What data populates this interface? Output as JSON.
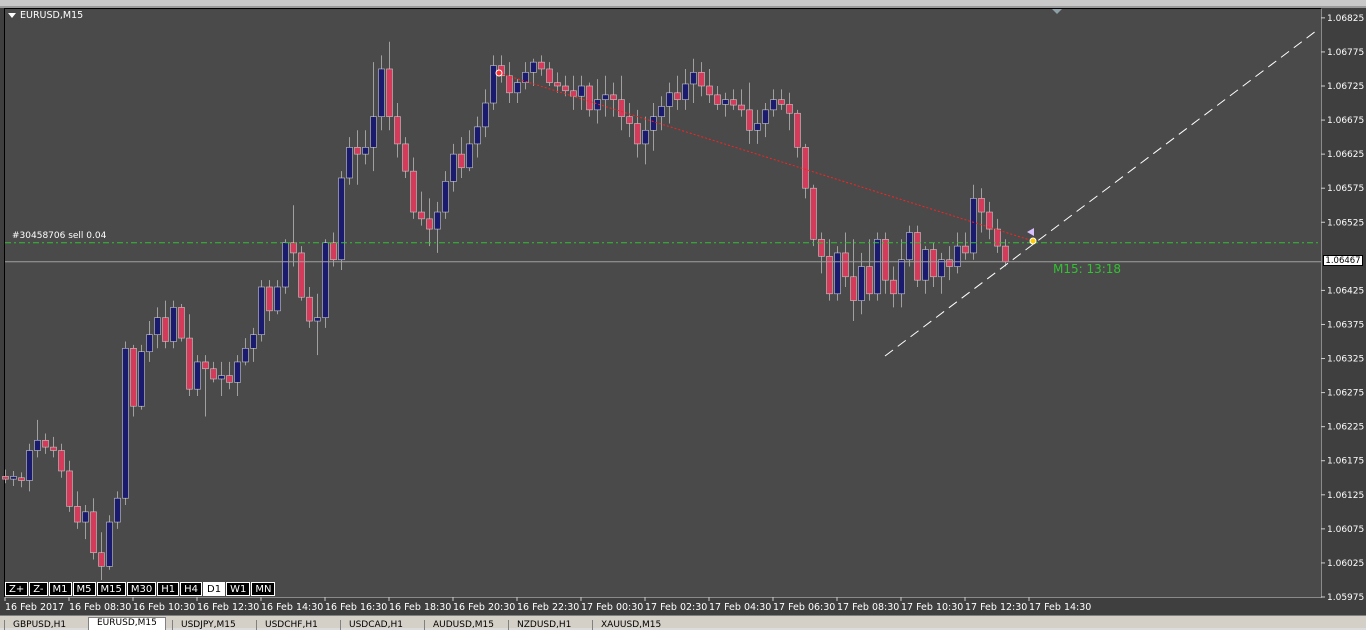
{
  "window": {
    "symbol_label": "EURUSD,M15"
  },
  "order_line": {
    "label": "#30458706 sell 0.04",
    "price": 1.06495,
    "color": "#33c033"
  },
  "current_price": {
    "value": 1.06467,
    "label": "1.06467",
    "color": "#a0a0a0"
  },
  "countdown": {
    "label": "M15: 13:18",
    "color": "#33c033"
  },
  "price_axis": {
    "labels": [
      "1.06825",
      "1.06775",
      "1.06725",
      "1.06675",
      "1.06625",
      "1.06575",
      "1.06525",
      "1.06425",
      "1.06375",
      "1.06325",
      "1.06275",
      "1.06225",
      "1.06175",
      "1.06125",
      "1.06075",
      "1.06025",
      "1.05975"
    ],
    "values": [
      1.06825,
      1.06775,
      1.06725,
      1.06675,
      1.06625,
      1.06575,
      1.06525,
      1.06425,
      1.06375,
      1.06325,
      1.06275,
      1.06225,
      1.06175,
      1.06125,
      1.06075,
      1.06025,
      1.05975
    ]
  },
  "time_axis": {
    "labels": [
      "16 Feb 2017",
      "16 Feb 08:30",
      "16 Feb 10:30",
      "16 Feb 12:30",
      "16 Feb 14:30",
      "16 Feb 16:30",
      "16 Feb 18:30",
      "16 Feb 20:30",
      "16 Feb 22:30",
      "17 Feb 00:30",
      "17 Feb 02:30",
      "17 Feb 04:30",
      "17 Feb 06:30",
      "17 Feb 08:30",
      "17 Feb 10:30",
      "17 Feb 12:30",
      "17 Feb 14:30"
    ]
  },
  "timeframe_buttons": [
    {
      "label": "Z+",
      "active": false
    },
    {
      "label": "Z-",
      "active": false
    },
    {
      "label": "M1",
      "active": false
    },
    {
      "label": "M5",
      "active": false
    },
    {
      "label": "M15",
      "active": false
    },
    {
      "label": "M30",
      "active": false
    },
    {
      "label": "H1",
      "active": false
    },
    {
      "label": "H4",
      "active": false
    },
    {
      "label": "D1",
      "active": true
    },
    {
      "label": "W1",
      "active": false
    },
    {
      "label": "MN",
      "active": false
    }
  ],
  "tabs": [
    {
      "label": "GBPUSD,H1",
      "active": false
    },
    {
      "label": "EURUSD,M15",
      "active": true
    },
    {
      "label": "USDJPY,M15",
      "active": false
    },
    {
      "label": "USDCHF,H1",
      "active": false
    },
    {
      "label": "USDCAD,H1",
      "active": false
    },
    {
      "label": "AUDUSD,M15",
      "active": false
    },
    {
      "label": "NZDUSD,H1",
      "active": false
    },
    {
      "label": "XAUUSD,M15",
      "active": false
    }
  ],
  "colors": {
    "bull": "#1a1a6e",
    "bear": "#d43a5a",
    "wick": "#a0a0a0",
    "background": "#4a4a4a"
  },
  "chart_data": {
    "type": "candlestick",
    "symbol": "EURUSD",
    "timeframe": "M15",
    "ylim": [
      1.05975,
      1.06838
    ],
    "candles": [
      {
        "o": 1.06152,
        "h": 1.06162,
        "l": 1.06142,
        "c": 1.06148
      },
      {
        "o": 1.06148,
        "h": 1.0616,
        "l": 1.06138,
        "c": 1.06152
      },
      {
        "o": 1.0615,
        "h": 1.06158,
        "l": 1.06136,
        "c": 1.06146
      },
      {
        "o": 1.06146,
        "h": 1.062,
        "l": 1.0613,
        "c": 1.0619
      },
      {
        "o": 1.0619,
        "h": 1.06235,
        "l": 1.0618,
        "c": 1.06205
      },
      {
        "o": 1.06205,
        "h": 1.06215,
        "l": 1.06185,
        "c": 1.06195
      },
      {
        "o": 1.06195,
        "h": 1.0621,
        "l": 1.0618,
        "c": 1.0619
      },
      {
        "o": 1.0619,
        "h": 1.062,
        "l": 1.0615,
        "c": 1.0616
      },
      {
        "o": 1.0616,
        "h": 1.06175,
        "l": 1.061,
        "c": 1.06108
      },
      {
        "o": 1.06108,
        "h": 1.0613,
        "l": 1.06075,
        "c": 1.06085
      },
      {
        "o": 1.06085,
        "h": 1.0611,
        "l": 1.0606,
        "c": 1.061
      },
      {
        "o": 1.061,
        "h": 1.0612,
        "l": 1.0603,
        "c": 1.0604
      },
      {
        "o": 1.0604,
        "h": 1.0607,
        "l": 1.06,
        "c": 1.0602
      },
      {
        "o": 1.0602,
        "h": 1.06095,
        "l": 1.06015,
        "c": 1.06085
      },
      {
        "o": 1.06085,
        "h": 1.0613,
        "l": 1.06075,
        "c": 1.0612
      },
      {
        "o": 1.0612,
        "h": 1.0635,
        "l": 1.0611,
        "c": 1.0634
      },
      {
        "o": 1.0634,
        "h": 1.06345,
        "l": 1.0624,
        "c": 1.06255
      },
      {
        "o": 1.06255,
        "h": 1.06345,
        "l": 1.0625,
        "c": 1.06335
      },
      {
        "o": 1.06335,
        "h": 1.0638,
        "l": 1.0632,
        "c": 1.0636
      },
      {
        "o": 1.0636,
        "h": 1.064,
        "l": 1.0634,
        "c": 1.06385
      },
      {
        "o": 1.06385,
        "h": 1.0641,
        "l": 1.0634,
        "c": 1.0635
      },
      {
        "o": 1.0635,
        "h": 1.0641,
        "l": 1.0634,
        "c": 1.064
      },
      {
        "o": 1.064,
        "h": 1.06405,
        "l": 1.0635,
        "c": 1.06355
      },
      {
        "o": 1.06355,
        "h": 1.0639,
        "l": 1.0627,
        "c": 1.0628
      },
      {
        "o": 1.0628,
        "h": 1.0633,
        "l": 1.0627,
        "c": 1.0632
      },
      {
        "o": 1.0632,
        "h": 1.0633,
        "l": 1.0624,
        "c": 1.0631
      },
      {
        "o": 1.0631,
        "h": 1.0632,
        "l": 1.0629,
        "c": 1.06295
      },
      {
        "o": 1.06295,
        "h": 1.0632,
        "l": 1.0627,
        "c": 1.063
      },
      {
        "o": 1.063,
        "h": 1.0632,
        "l": 1.0628,
        "c": 1.0629
      },
      {
        "o": 1.0629,
        "h": 1.0633,
        "l": 1.0627,
        "c": 1.0632
      },
      {
        "o": 1.0632,
        "h": 1.06355,
        "l": 1.06315,
        "c": 1.0634
      },
      {
        "o": 1.0634,
        "h": 1.0637,
        "l": 1.0632,
        "c": 1.0636
      },
      {
        "o": 1.0636,
        "h": 1.0644,
        "l": 1.0635,
        "c": 1.0643
      },
      {
        "o": 1.0643,
        "h": 1.0644,
        "l": 1.0638,
        "c": 1.06395
      },
      {
        "o": 1.06395,
        "h": 1.0644,
        "l": 1.0639,
        "c": 1.0643
      },
      {
        "o": 1.0643,
        "h": 1.065,
        "l": 1.0642,
        "c": 1.06495
      },
      {
        "o": 1.06495,
        "h": 1.0655,
        "l": 1.0646,
        "c": 1.0648
      },
      {
        "o": 1.0648,
        "h": 1.0649,
        "l": 1.0641,
        "c": 1.06415
      },
      {
        "o": 1.06415,
        "h": 1.0643,
        "l": 1.0637,
        "c": 1.0638
      },
      {
        "o": 1.0638,
        "h": 1.0642,
        "l": 1.0633,
        "c": 1.06385
      },
      {
        "o": 1.06385,
        "h": 1.065,
        "l": 1.0637,
        "c": 1.06495
      },
      {
        "o": 1.06495,
        "h": 1.0651,
        "l": 1.0646,
        "c": 1.0647
      },
      {
        "o": 1.0647,
        "h": 1.066,
        "l": 1.06455,
        "c": 1.0659
      },
      {
        "o": 1.0659,
        "h": 1.0665,
        "l": 1.0658,
        "c": 1.06635
      },
      {
        "o": 1.06635,
        "h": 1.0666,
        "l": 1.0658,
        "c": 1.06625
      },
      {
        "o": 1.06625,
        "h": 1.0666,
        "l": 1.0661,
        "c": 1.06635
      },
      {
        "o": 1.06635,
        "h": 1.0676,
        "l": 1.066,
        "c": 1.0668
      },
      {
        "o": 1.0668,
        "h": 1.0677,
        "l": 1.0666,
        "c": 1.0675
      },
      {
        "o": 1.0675,
        "h": 1.0679,
        "l": 1.0666,
        "c": 1.0668
      },
      {
        "o": 1.0668,
        "h": 1.067,
        "l": 1.0662,
        "c": 1.0664
      },
      {
        "o": 1.0664,
        "h": 1.0665,
        "l": 1.0659,
        "c": 1.066
      },
      {
        "o": 1.066,
        "h": 1.0662,
        "l": 1.0653,
        "c": 1.0654
      },
      {
        "o": 1.0654,
        "h": 1.0657,
        "l": 1.0652,
        "c": 1.0653
      },
      {
        "o": 1.0653,
        "h": 1.0656,
        "l": 1.0649,
        "c": 1.06515
      },
      {
        "o": 1.06515,
        "h": 1.06555,
        "l": 1.0648,
        "c": 1.0654
      },
      {
        "o": 1.0654,
        "h": 1.066,
        "l": 1.0653,
        "c": 1.06585
      },
      {
        "o": 1.06585,
        "h": 1.0664,
        "l": 1.0657,
        "c": 1.06625
      },
      {
        "o": 1.06625,
        "h": 1.0665,
        "l": 1.0659,
        "c": 1.06605
      },
      {
        "o": 1.06605,
        "h": 1.0666,
        "l": 1.066,
        "c": 1.0664
      },
      {
        "o": 1.0664,
        "h": 1.0668,
        "l": 1.0662,
        "c": 1.06665
      },
      {
        "o": 1.06665,
        "h": 1.0672,
        "l": 1.0665,
        "c": 1.067
      },
      {
        "o": 1.067,
        "h": 1.0677,
        "l": 1.0669,
        "c": 1.06755
      },
      {
        "o": 1.06755,
        "h": 1.0677,
        "l": 1.0673,
        "c": 1.0674
      },
      {
        "o": 1.0674,
        "h": 1.0676,
        "l": 1.067,
        "c": 1.06715
      },
      {
        "o": 1.06715,
        "h": 1.06735,
        "l": 1.067,
        "c": 1.0673
      },
      {
        "o": 1.0673,
        "h": 1.0676,
        "l": 1.0672,
        "c": 1.06745
      },
      {
        "o": 1.06745,
        "h": 1.06765,
        "l": 1.06725,
        "c": 1.0676
      },
      {
        "o": 1.0676,
        "h": 1.0677,
        "l": 1.0674,
        "c": 1.0675
      },
      {
        "o": 1.0675,
        "h": 1.0676,
        "l": 1.06725,
        "c": 1.0673
      },
      {
        "o": 1.0673,
        "h": 1.06745,
        "l": 1.06715,
        "c": 1.06725
      },
      {
        "o": 1.06725,
        "h": 1.0674,
        "l": 1.0671,
        "c": 1.06718
      },
      {
        "o": 1.06718,
        "h": 1.0674,
        "l": 1.0669,
        "c": 1.0671
      },
      {
        "o": 1.0671,
        "h": 1.0674,
        "l": 1.0669,
        "c": 1.06725
      },
      {
        "o": 1.06725,
        "h": 1.0673,
        "l": 1.0668,
        "c": 1.0669
      },
      {
        "o": 1.0669,
        "h": 1.06735,
        "l": 1.0667,
        "c": 1.06705
      },
      {
        "o": 1.06705,
        "h": 1.0674,
        "l": 1.0668,
        "c": 1.06712
      },
      {
        "o": 1.06712,
        "h": 1.0673,
        "l": 1.0668,
        "c": 1.06705
      },
      {
        "o": 1.06705,
        "h": 1.0674,
        "l": 1.0666,
        "c": 1.0668
      },
      {
        "o": 1.0668,
        "h": 1.067,
        "l": 1.0665,
        "c": 1.0667
      },
      {
        "o": 1.0667,
        "h": 1.0669,
        "l": 1.0662,
        "c": 1.0664
      },
      {
        "o": 1.0664,
        "h": 1.0668,
        "l": 1.0661,
        "c": 1.0666
      },
      {
        "o": 1.0666,
        "h": 1.067,
        "l": 1.0663,
        "c": 1.0668
      },
      {
        "o": 1.0668,
        "h": 1.0671,
        "l": 1.0666,
        "c": 1.06695
      },
      {
        "o": 1.06695,
        "h": 1.0673,
        "l": 1.0667,
        "c": 1.06715
      },
      {
        "o": 1.06715,
        "h": 1.0674,
        "l": 1.0669,
        "c": 1.06705
      },
      {
        "o": 1.06705,
        "h": 1.0675,
        "l": 1.0669,
        "c": 1.06728
      },
      {
        "o": 1.06728,
        "h": 1.06765,
        "l": 1.067,
        "c": 1.06745
      },
      {
        "o": 1.06745,
        "h": 1.0676,
        "l": 1.0671,
        "c": 1.06725
      },
      {
        "o": 1.06725,
        "h": 1.0675,
        "l": 1.067,
        "c": 1.06712
      },
      {
        "o": 1.06712,
        "h": 1.06725,
        "l": 1.0669,
        "c": 1.06698
      },
      {
        "o": 1.06698,
        "h": 1.06715,
        "l": 1.0668,
        "c": 1.06705
      },
      {
        "o": 1.06705,
        "h": 1.0672,
        "l": 1.0669,
        "c": 1.06697
      },
      {
        "o": 1.06697,
        "h": 1.0672,
        "l": 1.0668,
        "c": 1.0669
      },
      {
        "o": 1.0669,
        "h": 1.0673,
        "l": 1.0664,
        "c": 1.0666
      },
      {
        "o": 1.0666,
        "h": 1.0669,
        "l": 1.0664,
        "c": 1.0667
      },
      {
        "o": 1.0667,
        "h": 1.067,
        "l": 1.0665,
        "c": 1.0669
      },
      {
        "o": 1.0669,
        "h": 1.0672,
        "l": 1.0668,
        "c": 1.06705
      },
      {
        "o": 1.06705,
        "h": 1.0672,
        "l": 1.0669,
        "c": 1.06698
      },
      {
        "o": 1.06698,
        "h": 1.06715,
        "l": 1.0666,
        "c": 1.06685
      },
      {
        "o": 1.06685,
        "h": 1.0669,
        "l": 1.0662,
        "c": 1.06635
      },
      {
        "o": 1.06635,
        "h": 1.0664,
        "l": 1.0656,
        "c": 1.06575
      },
      {
        "o": 1.06575,
        "h": 1.0658,
        "l": 1.0649,
        "c": 1.065
      },
      {
        "o": 1.065,
        "h": 1.0651,
        "l": 1.0645,
        "c": 1.06475
      },
      {
        "o": 1.06475,
        "h": 1.065,
        "l": 1.0641,
        "c": 1.0642
      },
      {
        "o": 1.0642,
        "h": 1.0649,
        "l": 1.0641,
        "c": 1.0648
      },
      {
        "o": 1.0648,
        "h": 1.0651,
        "l": 1.0643,
        "c": 1.06445
      },
      {
        "o": 1.06445,
        "h": 1.065,
        "l": 1.0638,
        "c": 1.0641
      },
      {
        "o": 1.0641,
        "h": 1.0648,
        "l": 1.0639,
        "c": 1.0646
      },
      {
        "o": 1.0646,
        "h": 1.065,
        "l": 1.0641,
        "c": 1.0642
      },
      {
        "o": 1.0642,
        "h": 1.0651,
        "l": 1.0641,
        "c": 1.065
      },
      {
        "o": 1.065,
        "h": 1.0651,
        "l": 1.0642,
        "c": 1.0644
      },
      {
        "o": 1.0644,
        "h": 1.0646,
        "l": 1.064,
        "c": 1.0642
      },
      {
        "o": 1.0642,
        "h": 1.065,
        "l": 1.064,
        "c": 1.0647
      },
      {
        "o": 1.0647,
        "h": 1.0652,
        "l": 1.0646,
        "c": 1.0651
      },
      {
        "o": 1.0651,
        "h": 1.0652,
        "l": 1.0643,
        "c": 1.0644
      },
      {
        "o": 1.0644,
        "h": 1.0649,
        "l": 1.0642,
        "c": 1.06485
      },
      {
        "o": 1.06485,
        "h": 1.06495,
        "l": 1.0643,
        "c": 1.06445
      },
      {
        "o": 1.06445,
        "h": 1.0648,
        "l": 1.0642,
        "c": 1.0647
      },
      {
        "o": 1.0647,
        "h": 1.0649,
        "l": 1.0644,
        "c": 1.0646
      },
      {
        "o": 1.0646,
        "h": 1.0651,
        "l": 1.0645,
        "c": 1.0649
      },
      {
        "o": 1.0649,
        "h": 1.0651,
        "l": 1.0647,
        "c": 1.0648
      },
      {
        "o": 1.0648,
        "h": 1.0658,
        "l": 1.0647,
        "c": 1.0656
      },
      {
        "o": 1.0656,
        "h": 1.06575,
        "l": 1.0651,
        "c": 1.0654
      },
      {
        "o": 1.0654,
        "h": 1.06555,
        "l": 1.065,
        "c": 1.06515
      },
      {
        "o": 1.06515,
        "h": 1.0653,
        "l": 1.0648,
        "c": 1.0649
      },
      {
        "o": 1.0649,
        "h": 1.065,
        "l": 1.0646,
        "c": 1.06467
      }
    ]
  }
}
